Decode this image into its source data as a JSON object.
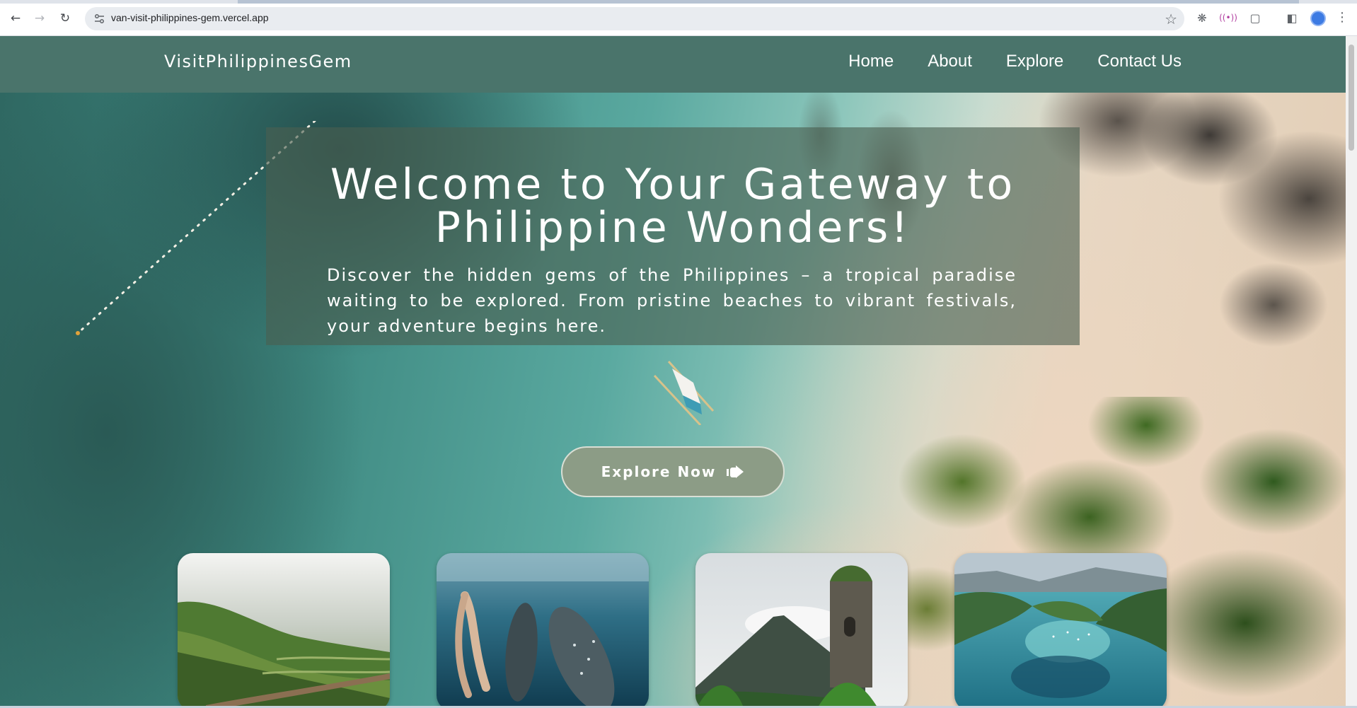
{
  "browser": {
    "url": "van-visit-philippines-gem.vercel.app",
    "back_icon": "arrow-left",
    "forward_icon": "arrow-right",
    "reload_icon": "reload",
    "bookmark_icon": "star"
  },
  "header": {
    "logo": "VisitPhilippinesGem",
    "nav": [
      {
        "label": "Home"
      },
      {
        "label": "About"
      },
      {
        "label": "Explore"
      },
      {
        "label": "Contact Us"
      }
    ],
    "background_color": "#4a746b"
  },
  "hero": {
    "title": "Welcome to Your Gateway to Philippine Wonders!",
    "subtitle": "Discover the hidden gems of the Philippines – a tropical paradise waiting to be explored. From pristine beaches to vibrant festivals, your adventure begins here.",
    "cta_label": "Explore Now",
    "cta_icon": "hand-pointing-right-icon"
  },
  "gallery": [
    {
      "name": "rice-terraces-image"
    },
    {
      "name": "whale-shark-swim-image"
    },
    {
      "name": "mayon-volcano-cagsawa-image"
    },
    {
      "name": "el-nido-lagoon-image"
    }
  ]
}
